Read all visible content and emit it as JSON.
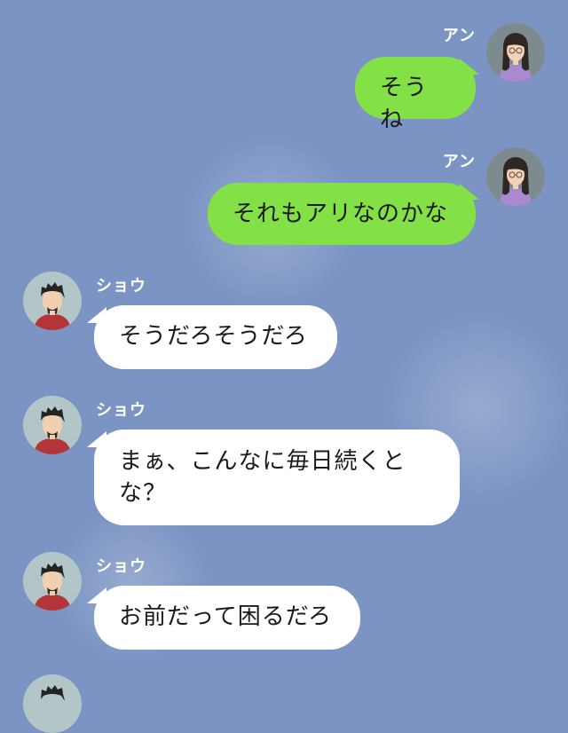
{
  "chat": {
    "messages": [
      {
        "sender": "アン",
        "side": "right",
        "text": "そうね"
      },
      {
        "sender": "アン",
        "side": "right",
        "text": "それもアリなのかな"
      },
      {
        "sender": "ショウ",
        "side": "left",
        "text": "そうだろそうだろ"
      },
      {
        "sender": "ショウ",
        "side": "left",
        "text": "まぁ、こんなに毎日続くとな？"
      },
      {
        "sender": "ショウ",
        "side": "left",
        "text": "お前だって困るだろ"
      }
    ]
  },
  "colors": {
    "background": "#7b94c3",
    "outgoing_bubble": "#84e047",
    "incoming_bubble": "#ffffff",
    "name_text": "#ffffff"
  },
  "icons": {
    "an_avatar": "woman-long-hair-glasses-avatar",
    "shou_avatar": "man-spiky-hair-beard-avatar"
  }
}
